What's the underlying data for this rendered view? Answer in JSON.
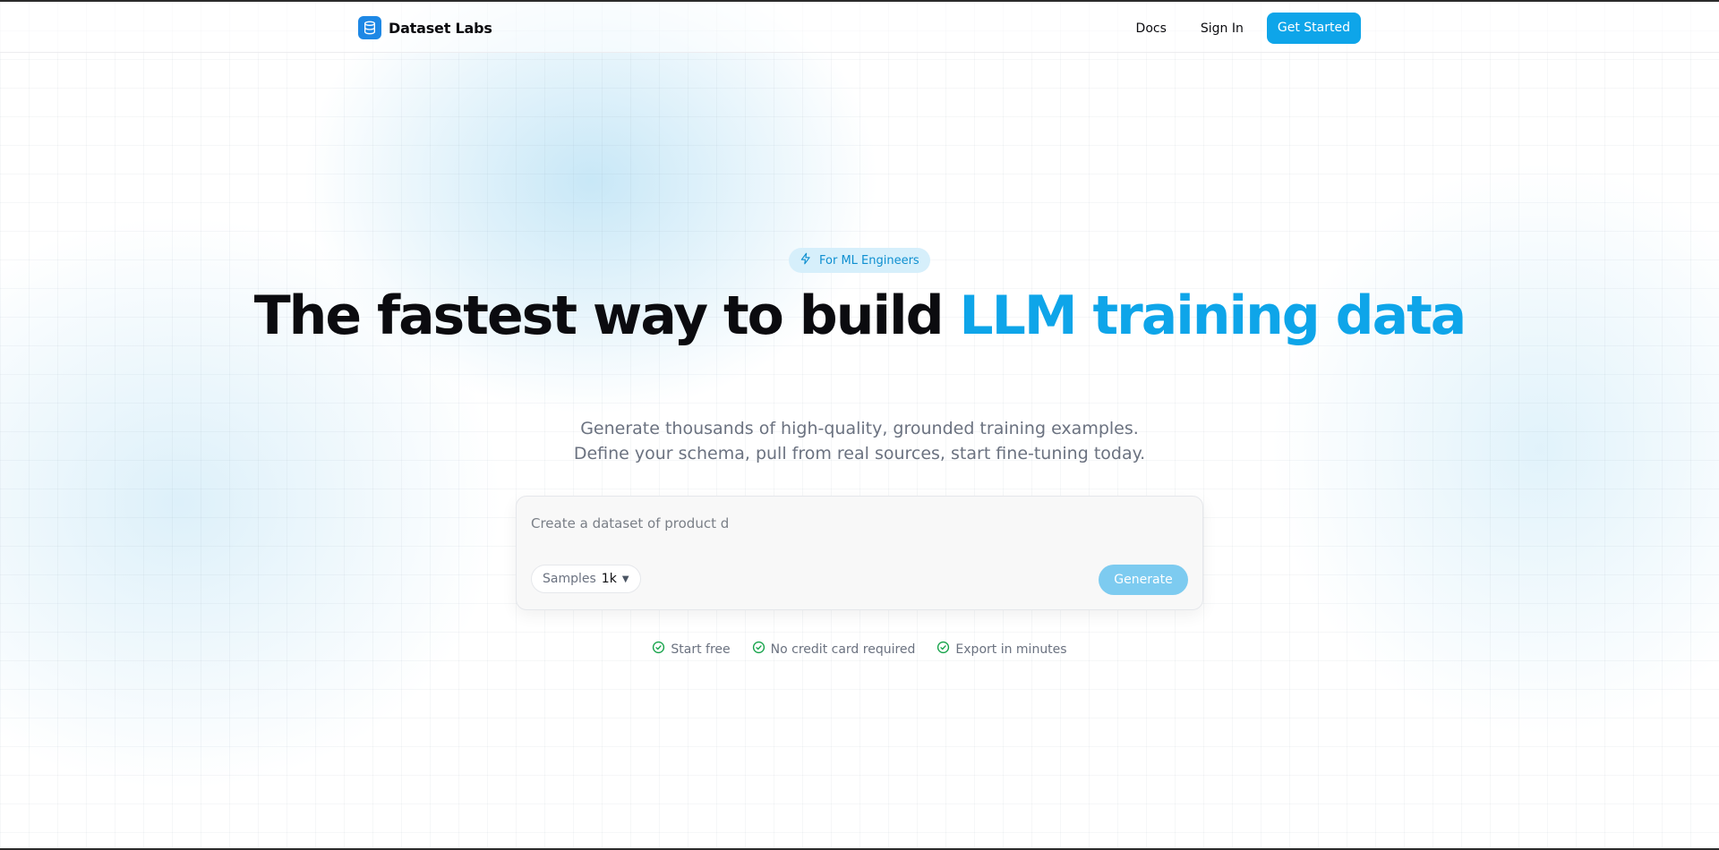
{
  "header": {
    "brand": "Dataset Labs",
    "nav": {
      "docs": "Docs",
      "sign_in": "Sign In",
      "get_started": "Get Started"
    }
  },
  "hero": {
    "badge": "For ML Engineers",
    "headline_main": "The fastest way to build ",
    "headline_accent": "LLM training data",
    "subheadline": "Generate thousands of high-quality, grounded training examples. Define your schema, pull from real sources, start fine-tuning today."
  },
  "prompt": {
    "input_value": "Create a dataset of product d",
    "samples_label": "Samples",
    "samples_value": "1k",
    "generate_label": "Generate"
  },
  "features": [
    {
      "label": "Start free"
    },
    {
      "label": "No credit card required"
    },
    {
      "label": "Export in minutes"
    }
  ],
  "colors": {
    "accent": "#0ea5e9",
    "brand_logo": "#1e88e5",
    "badge_bg": "#d6effb",
    "generate_disabled": "#7dcbf0",
    "check_green": "#16a34a",
    "text_muted": "#6b7280"
  },
  "icons": {
    "brand": "database-icon",
    "badge": "lightning-icon",
    "feature": "check-circle-icon",
    "samples_caret": "caret-down-icon"
  }
}
